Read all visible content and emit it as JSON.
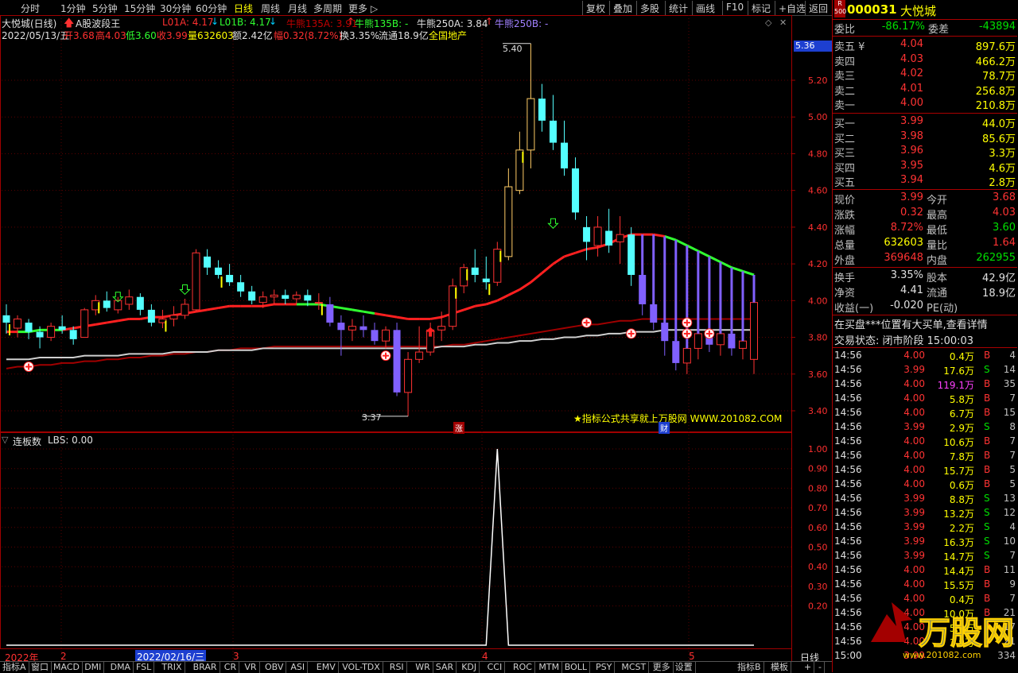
{
  "toolbar": {
    "periods": [
      "分时",
      "1分钟",
      "5分钟",
      "15分钟",
      "30分钟",
      "60分钟",
      "日线",
      "周线",
      "月线",
      "多周期",
      "更多"
    ],
    "active_period": "日线",
    "right_buttons": [
      "复权",
      "叠加",
      "多股",
      "统计",
      "画线",
      "F10",
      "标记",
      "+自选",
      "返回"
    ]
  },
  "info": {
    "stock_label": "大悦城(日线)",
    "indicator_name": "A股波段王",
    "l01a": "L01A: 4.17",
    "l01b": "L01B: 4.17",
    "niu135a": "牛熊135A: 3.91",
    "niu135b": "牛熊135B: -",
    "niu250a": "牛熊250A: 3.84",
    "niu250b": "牛熊250B: -",
    "date": "2022/05/13/五",
    "open": "开3.68",
    "high": "高4.03",
    "low": "低3.60",
    "close": "收3.99",
    "vol": "量632603",
    "amount": "额2.42亿",
    "change": "幅0.32(8.72%)",
    "turnover": "换3.35%",
    "float": "流通18.9亿",
    "sector": "全国地产"
  },
  "chart": {
    "price_axis": [
      "5.20",
      "5.00",
      "4.80",
      "4.60",
      "4.40",
      "4.20",
      "4.00",
      "3.80",
      "3.60",
      "3.40"
    ],
    "current_price_tag": "5.36",
    "high_marker": "5.40",
    "low_marker": "3.37",
    "watermark": "★指标公式共享就上万股网 WWW.201082.COM",
    "zhang_tag": "涨",
    "cai_tag": "财"
  },
  "chart_data": {
    "type": "candlestick",
    "y_range": [
      3.28,
      5.58
    ],
    "candles": [
      [
        3.92,
        3.98,
        3.82,
        3.88
      ],
      [
        3.85,
        3.92,
        3.8,
        3.9
      ],
      [
        3.88,
        3.9,
        3.79,
        3.83
      ],
      [
        3.83,
        3.86,
        3.74,
        3.8
      ],
      [
        3.8,
        3.88,
        3.78,
        3.86
      ],
      [
        3.86,
        3.92,
        3.82,
        3.84
      ],
      [
        3.84,
        3.86,
        3.76,
        3.79
      ],
      [
        3.8,
        3.96,
        3.8,
        3.95
      ],
      [
        3.95,
        4.03,
        3.92,
        4.0
      ],
      [
        4.0,
        4.05,
        3.94,
        3.96
      ],
      [
        3.95,
        4.02,
        3.93,
        4.0
      ],
      [
        3.98,
        4.06,
        3.95,
        4.02
      ],
      [
        4.02,
        4.04,
        3.92,
        3.95
      ],
      [
        3.95,
        3.98,
        3.86,
        3.88
      ],
      [
        3.88,
        3.95,
        3.85,
        3.9
      ],
      [
        3.9,
        3.97,
        3.86,
        3.92
      ],
      [
        3.92,
        4.01,
        3.9,
        3.98
      ],
      [
        3.95,
        4.28,
        3.94,
        4.26
      ],
      [
        4.24,
        4.28,
        4.14,
        4.18
      ],
      [
        4.18,
        4.22,
        4.12,
        4.14
      ],
      [
        4.14,
        4.2,
        4.08,
        4.1
      ],
      [
        4.1,
        4.14,
        4.02,
        4.05
      ],
      [
        4.05,
        4.08,
        3.98,
        4.0
      ],
      [
        3.99,
        4.05,
        3.96,
        4.02
      ],
      [
        4.02,
        4.06,
        3.98,
        4.03
      ],
      [
        4.03,
        4.06,
        3.98,
        4.01
      ],
      [
        4.01,
        4.05,
        3.98,
        4.03
      ],
      [
        4.03,
        4.06,
        3.97,
        4.0
      ],
      [
        3.99,
        4.04,
        3.95,
        3.99
      ],
      [
        3.98,
        4.02,
        3.86,
        3.88
      ],
      [
        3.88,
        3.92,
        3.7,
        3.84
      ],
      [
        3.84,
        3.9,
        3.78,
        3.86
      ],
      [
        3.86,
        3.92,
        3.8,
        3.84
      ],
      [
        3.84,
        3.88,
        3.76,
        3.78
      ],
      [
        3.78,
        3.86,
        3.74,
        3.84
      ],
      [
        3.84,
        3.88,
        3.48,
        3.5
      ],
      [
        3.5,
        3.72,
        3.37,
        3.68
      ],
      [
        3.68,
        3.86,
        3.66,
        3.72
      ],
      [
        3.72,
        3.88,
        3.7,
        3.84
      ],
      [
        3.84,
        3.94,
        3.78,
        3.86
      ],
      [
        3.86,
        4.12,
        3.84,
        4.08
      ],
      [
        4.08,
        4.2,
        4.04,
        4.18
      ],
      [
        4.18,
        4.28,
        4.1,
        4.14
      ],
      [
        4.12,
        4.24,
        4.06,
        4.1
      ],
      [
        4.1,
        4.32,
        4.08,
        4.28
      ],
      [
        4.24,
        4.72,
        4.22,
        4.62
      ],
      [
        4.6,
        4.92,
        4.58,
        4.82
      ],
      [
        4.82,
        5.4,
        4.72,
        5.1
      ],
      [
        5.1,
        5.18,
        4.92,
        4.98
      ],
      [
        4.98,
        5.12,
        4.82,
        4.86
      ],
      [
        4.86,
        4.98,
        4.68,
        4.72
      ],
      [
        4.72,
        4.78,
        4.44,
        4.48
      ],
      [
        4.4,
        4.46,
        4.22,
        4.32
      ],
      [
        4.3,
        4.46,
        4.24,
        4.4
      ],
      [
        4.38,
        4.5,
        4.26,
        4.3
      ],
      [
        4.32,
        4.46,
        4.2,
        4.36
      ],
      [
        4.36,
        4.4,
        4.08,
        4.14
      ],
      [
        4.14,
        4.18,
        3.92,
        3.98
      ],
      [
        3.98,
        4.04,
        3.84,
        3.88
      ],
      [
        3.88,
        3.96,
        3.7,
        3.78
      ],
      [
        3.78,
        3.86,
        3.62,
        3.66
      ],
      [
        3.66,
        3.8,
        3.6,
        3.74
      ],
      [
        3.74,
        3.88,
        3.68,
        3.82
      ],
      [
        3.82,
        3.9,
        3.72,
        3.76
      ],
      [
        3.76,
        3.86,
        3.7,
        3.82
      ],
      [
        3.82,
        3.86,
        3.7,
        3.74
      ],
      [
        3.74,
        3.82,
        3.68,
        3.78
      ],
      [
        3.68,
        4.03,
        3.6,
        3.99
      ]
    ],
    "ma_short": [
      3.83,
      3.83,
      3.83,
      3.84,
      3.84,
      3.84,
      3.85,
      3.86,
      3.87,
      3.88,
      3.89,
      3.9,
      3.9,
      3.91,
      3.91,
      3.92,
      3.93,
      3.94,
      3.95,
      3.96,
      3.97,
      3.97,
      3.97,
      3.97,
      3.98,
      3.98,
      3.98,
      3.98,
      3.98,
      3.97,
      3.96,
      3.95,
      3.94,
      3.93,
      3.92,
      3.91,
      3.9,
      3.9,
      3.9,
      3.91,
      3.93,
      3.95,
      3.97,
      3.98,
      4.0,
      4.03,
      4.06,
      4.1,
      4.15,
      4.2,
      4.24,
      4.26,
      4.28,
      4.29,
      4.31,
      4.34,
      4.36,
      4.36,
      4.36,
      4.35,
      4.33,
      4.3,
      4.27,
      4.24,
      4.21,
      4.18,
      4.16,
      4.14
    ],
    "ma_long": [
      3.63,
      3.64,
      3.64,
      3.65,
      3.65,
      3.66,
      3.66,
      3.67,
      3.67,
      3.68,
      3.68,
      3.69,
      3.69,
      3.7,
      3.7,
      3.71,
      3.71,
      3.72,
      3.72,
      3.73,
      3.73,
      3.74,
      3.74,
      3.74,
      3.75,
      3.75,
      3.75,
      3.75,
      3.75,
      3.75,
      3.75,
      3.75,
      3.75,
      3.75,
      3.75,
      3.75,
      3.75,
      3.75,
      3.75,
      3.75,
      3.76,
      3.76,
      3.77,
      3.78,
      3.79,
      3.8,
      3.81,
      3.82,
      3.83,
      3.84,
      3.85,
      3.86,
      3.87,
      3.87,
      3.88,
      3.89,
      3.89,
      3.9,
      3.9,
      3.9,
      3.9,
      3.9,
      3.9,
      3.9,
      3.9,
      3.9,
      3.9,
      3.9
    ],
    "ma_white": [
      3.68,
      3.68,
      3.68,
      3.69,
      3.69,
      3.69,
      3.69,
      3.7,
      3.7,
      3.7,
      3.7,
      3.71,
      3.71,
      3.71,
      3.71,
      3.72,
      3.72,
      3.72,
      3.72,
      3.73,
      3.73,
      3.73,
      3.73,
      3.74,
      3.74,
      3.74,
      3.74,
      3.74,
      3.74,
      3.74,
      3.74,
      3.74,
      3.74,
      3.74,
      3.74,
      3.74,
      3.74,
      3.74,
      3.74,
      3.75,
      3.75,
      3.75,
      3.76,
      3.76,
      3.77,
      3.77,
      3.78,
      3.78,
      3.79,
      3.79,
      3.8,
      3.8,
      3.81,
      3.81,
      3.82,
      3.82,
      3.83,
      3.83,
      3.83,
      3.84,
      3.84,
      3.84,
      3.84,
      3.84,
      3.84,
      3.84,
      3.84,
      3.84
    ],
    "lbs_axis": [
      "1.00",
      "0.90",
      "0.80",
      "0.70",
      "0.60",
      "0.50",
      "0.40",
      "0.30",
      "0.20"
    ],
    "lbs_peak_index": 44,
    "lbs_title": "连板数",
    "lbs_value": "LBS: 0.00",
    "x_labels": [
      "2022年",
      "2",
      "2022/02/16/三",
      "3",
      "4",
      "5"
    ]
  },
  "quote": {
    "code": "000031",
    "name": "大悦城",
    "weibi_label": "委比",
    "weibi": "-86.17%",
    "weicha_label": "委差",
    "weicha": "-43894",
    "asks": [
      {
        "label": "卖五",
        "price": "4.04",
        "vol": "897.6万"
      },
      {
        "label": "卖四",
        "price": "4.03",
        "vol": "466.2万"
      },
      {
        "label": "卖三",
        "price": "4.02",
        "vol": "78.7万"
      },
      {
        "label": "卖二",
        "price": "4.01",
        "vol": "256.8万"
      },
      {
        "label": "卖一",
        "price": "4.00",
        "vol": "210.8万"
      }
    ],
    "bids": [
      {
        "label": "买一",
        "price": "3.99",
        "vol": "44.0万"
      },
      {
        "label": "买二",
        "price": "3.98",
        "vol": "85.6万"
      },
      {
        "label": "买三",
        "price": "3.96",
        "vol": "3.3万"
      },
      {
        "label": "买四",
        "price": "3.95",
        "vol": "4.6万"
      },
      {
        "label": "买五",
        "price": "3.94",
        "vol": "2.8万"
      }
    ],
    "stats": [
      {
        "l1": "现价",
        "v1": "3.99",
        "c1": "red",
        "l2": "今开",
        "v2": "3.68",
        "c2": "red"
      },
      {
        "l1": "涨跌",
        "v1": "0.32",
        "c1": "red",
        "l2": "最高",
        "v2": "4.03",
        "c2": "red"
      },
      {
        "l1": "涨幅",
        "v1": "8.72%",
        "c1": "red",
        "l2": "最低",
        "v2": "3.60",
        "c2": "green"
      },
      {
        "l1": "总量",
        "v1": "632603",
        "c1": "yellow",
        "l2": "量比",
        "v2": "1.64",
        "c2": "red"
      },
      {
        "l1": "外盘",
        "v1": "369648",
        "c1": "red",
        "l2": "内盘",
        "v2": "262955",
        "c2": "green"
      }
    ],
    "stats2": [
      {
        "l1": "换手",
        "v1": "3.35%",
        "l2": "股本",
        "v2": "42.9亿"
      },
      {
        "l1": "净资",
        "v1": "4.41",
        "l2": "流通",
        "v2": "18.9亿"
      },
      {
        "l1": "收益(一)",
        "v1": "-0.020",
        "l2": "PE(动)",
        "v2": ""
      }
    ],
    "notice": "在买盘***位置有大买单,查看详情",
    "status": "交易状态: 闭市阶段 15:00:03",
    "ticks": [
      {
        "t": "14:56",
        "p": "4.00",
        "v": "0.4万",
        "s": "B",
        "n": "4"
      },
      {
        "t": "14:56",
        "p": "3.99",
        "v": "17.6万",
        "s": "S",
        "n": "14"
      },
      {
        "t": "14:56",
        "p": "4.00",
        "v": "119.1万",
        "s": "B",
        "n": "35"
      },
      {
        "t": "14:56",
        "p": "4.00",
        "v": "5.8万",
        "s": "B",
        "n": "7"
      },
      {
        "t": "14:56",
        "p": "4.00",
        "v": "6.7万",
        "s": "B",
        "n": "15"
      },
      {
        "t": "14:56",
        "p": "3.99",
        "v": "2.9万",
        "s": "S",
        "n": "8"
      },
      {
        "t": "14:56",
        "p": "4.00",
        "v": "10.6万",
        "s": "B",
        "n": "7"
      },
      {
        "t": "14:56",
        "p": "4.00",
        "v": "7.8万",
        "s": "B",
        "n": "7"
      },
      {
        "t": "14:56",
        "p": "4.00",
        "v": "15.7万",
        "s": "B",
        "n": "5"
      },
      {
        "t": "14:56",
        "p": "4.00",
        "v": "0.6万",
        "s": "B",
        "n": "5"
      },
      {
        "t": "14:56",
        "p": "3.99",
        "v": "8.8万",
        "s": "S",
        "n": "13"
      },
      {
        "t": "14:56",
        "p": "3.99",
        "v": "13.2万",
        "s": "S",
        "n": "12"
      },
      {
        "t": "14:56",
        "p": "3.99",
        "v": "2.2万",
        "s": "S",
        "n": "4"
      },
      {
        "t": "14:56",
        "p": "3.99",
        "v": "16.3万",
        "s": "S",
        "n": "10"
      },
      {
        "t": "14:56",
        "p": "3.99",
        "v": "14.7万",
        "s": "S",
        "n": "7"
      },
      {
        "t": "14:56",
        "p": "4.00",
        "v": "14.4万",
        "s": "B",
        "n": "11"
      },
      {
        "t": "14:56",
        "p": "4.00",
        "v": "15.5万",
        "s": "B",
        "n": "9"
      },
      {
        "t": "14:56",
        "p": "4.00",
        "v": "0.4万",
        "s": "B",
        "n": "7"
      },
      {
        "t": "14:56",
        "p": "4.00",
        "v": "10.0万",
        "s": "B",
        "n": "21"
      },
      {
        "t": "14:56",
        "p": "4.00",
        "v": "5.8万",
        "s": "B",
        "n": "17"
      },
      {
        "t": "14:56",
        "p": "4.00",
        "v": "3.9万",
        "s": "B",
        "n": "21"
      },
      {
        "t": "15:00",
        "p": "3.99",
        "v": "",
        "s": "",
        "n": "334"
      }
    ]
  },
  "bottom": {
    "tabs": [
      "指标A",
      "窗口",
      "MACD",
      "DMI",
      "DMA",
      "FSL",
      "TRIX",
      "BRAR",
      "CR",
      "VR",
      "OBV",
      "ASI",
      "EMV",
      "VOL-TDX",
      "RSI",
      "WR",
      "SAR",
      "KDJ",
      "CCI",
      "ROC",
      "MTM",
      "BOLL",
      "PSY",
      "MCST",
      "更多",
      "设置"
    ],
    "right_tabs": [
      "指标B",
      "模板"
    ],
    "daily_btn": "日线"
  },
  "colors": {
    "up": "#ff3232",
    "down_cyan": "#54ffff",
    "down_purple": "#8060ff",
    "ma_red": "#ff2020",
    "ma_green": "#30ff30",
    "ma_dark": "#a00000",
    "ma_white": "#d0d0d0"
  }
}
